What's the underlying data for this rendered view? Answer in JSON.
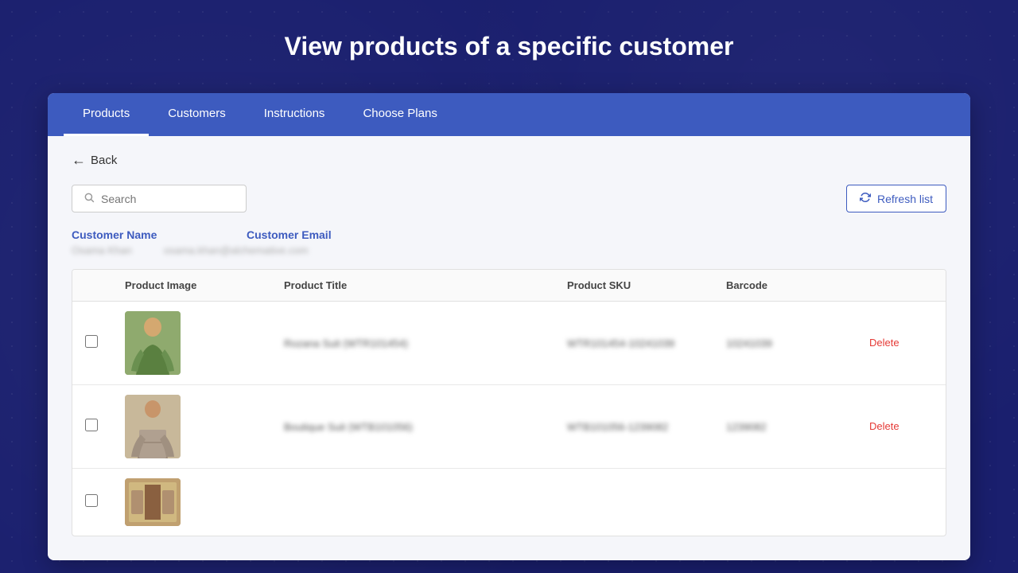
{
  "page": {
    "title": "View products of a specific customer"
  },
  "nav": {
    "items": [
      {
        "label": "Products",
        "active": true
      },
      {
        "label": "Customers",
        "active": false
      },
      {
        "label": "Instructions",
        "active": false
      },
      {
        "label": "Choose Plans",
        "active": false
      }
    ]
  },
  "back_button": {
    "label": "Back"
  },
  "search": {
    "placeholder": "Search"
  },
  "refresh_button": {
    "label": "Refresh list"
  },
  "customer": {
    "name_label": "Customer Name",
    "name_value": "Osama Khan",
    "email_label": "Customer Email",
    "email_value": "osama.khan@alchemative.com"
  },
  "table": {
    "headers": [
      "",
      "Product Image",
      "Product Title",
      "Product SKU",
      "Barcode",
      ""
    ],
    "rows": [
      {
        "product_title": "Rozana Suit (WTR101454)",
        "product_sku": "WTR101454-10241039",
        "barcode": "10241039",
        "delete_label": "Delete",
        "image_type": "1"
      },
      {
        "product_title": "Boutique Suit (WTB101056)",
        "product_sku": "WTB101056-1239082",
        "barcode": "1239082",
        "delete_label": "Delete",
        "image_type": "2"
      },
      {
        "product_title": "",
        "product_sku": "",
        "barcode": "",
        "delete_label": "",
        "image_type": "3"
      }
    ]
  }
}
